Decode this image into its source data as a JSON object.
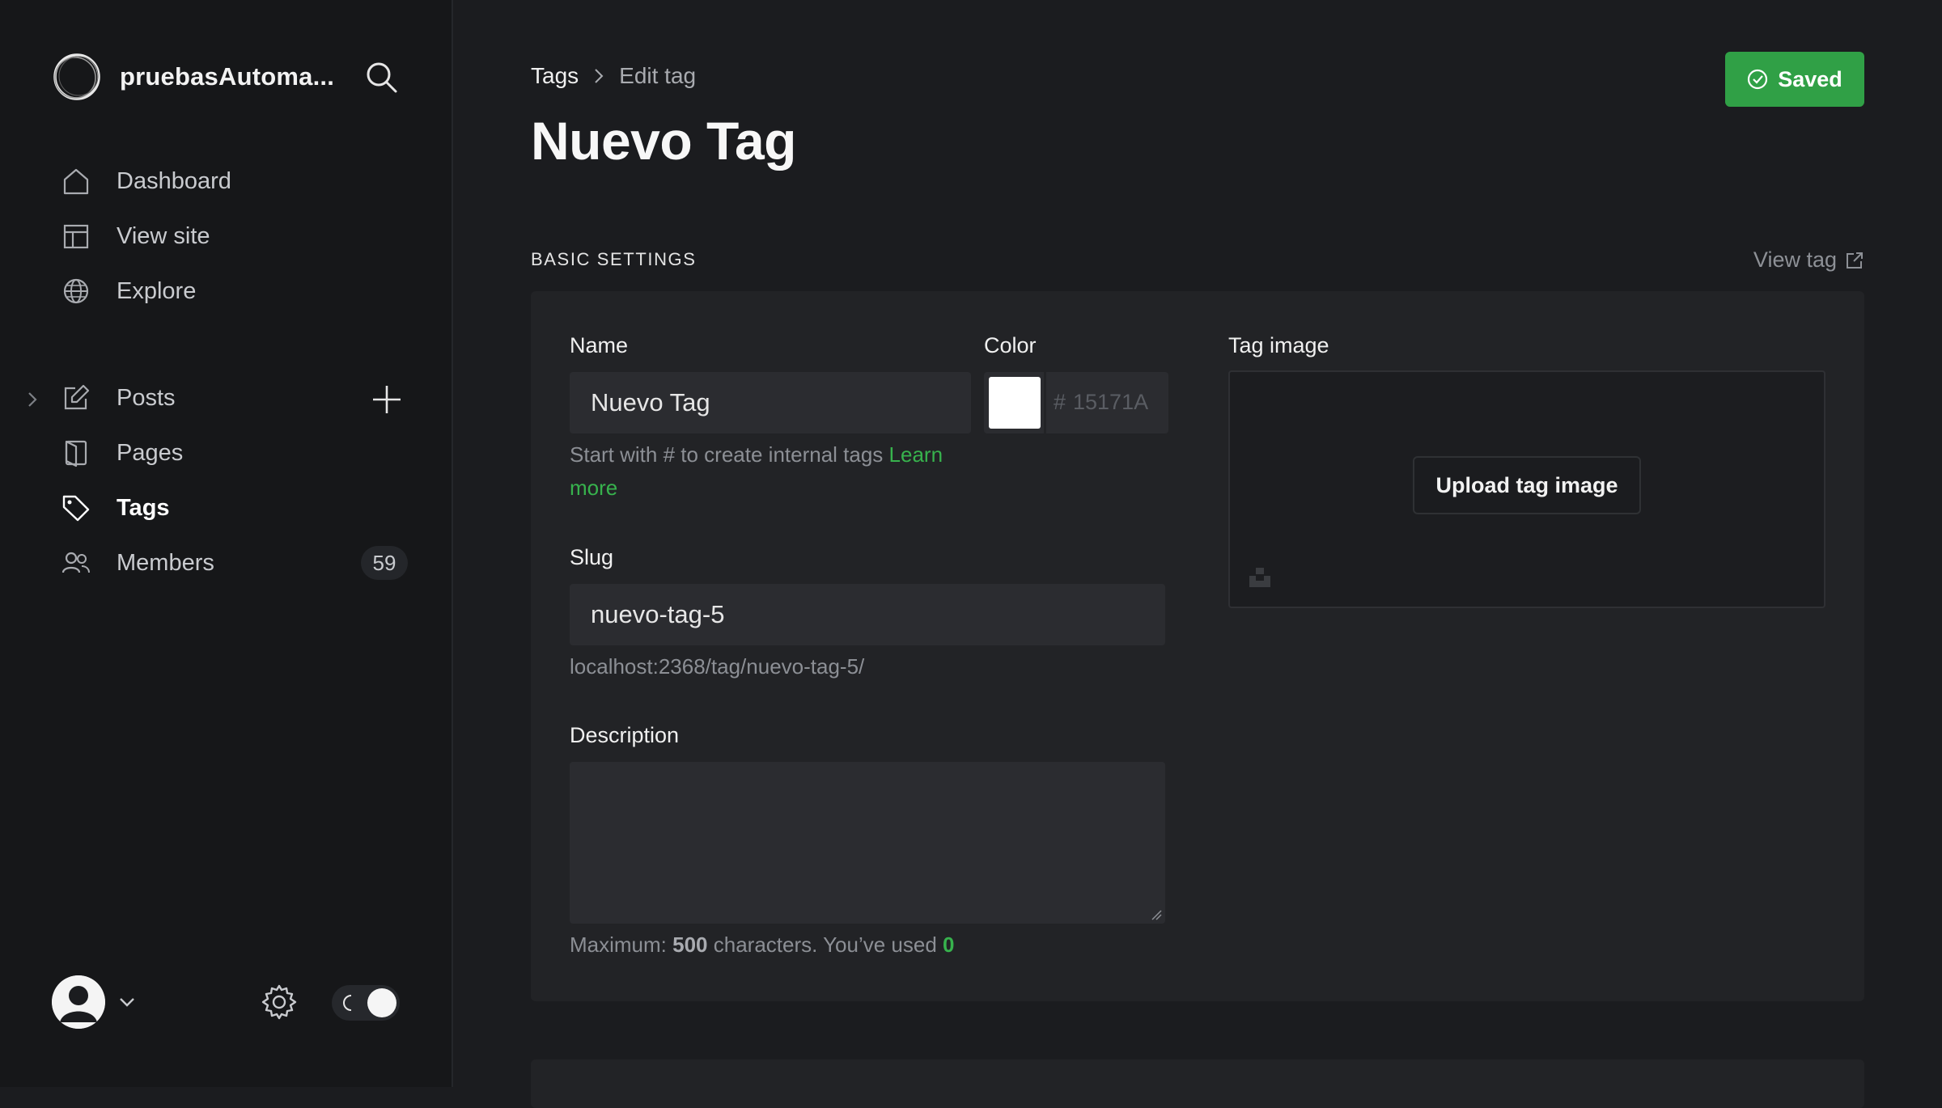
{
  "sidebar": {
    "brand_name": "pruebasAutoma...",
    "nav": {
      "dashboard": "Dashboard",
      "view_site": "View site",
      "explore": "Explore",
      "posts": "Posts",
      "pages": "Pages",
      "tags": "Tags",
      "members": "Members",
      "members_count": "59"
    },
    "active_item": "Tags"
  },
  "header": {
    "breadcrumb_parent": "Tags",
    "breadcrumb_current": "Edit tag",
    "title": "Nuevo Tag",
    "saved_label": "Saved"
  },
  "section": {
    "heading": "BASIC SETTINGS",
    "view_tag": "View tag"
  },
  "form": {
    "name_label": "Name",
    "name_value": "Nuevo Tag",
    "name_hint": "Start with # to create internal tags ",
    "name_hint_link_1": "Learn",
    "name_hint_link_2": "more",
    "color_label": "Color",
    "color_hash": "#",
    "color_placeholder": "15171A",
    "color_value": "#ffffff",
    "slug_label": "Slug",
    "slug_value": "nuevo-tag-5",
    "slug_url": "localhost:2368/tag/nuevo-tag-5/",
    "description_label": "Description",
    "description_value": "",
    "desc_hint_prefix": "Maximum: ",
    "desc_hint_max": "500",
    "desc_hint_middle": " characters. You’ve used ",
    "desc_hint_used": "0",
    "image_label": "Tag image",
    "upload_label": "Upload tag image"
  },
  "colors": {
    "accent": "#30a046",
    "link_green": "#37b24d",
    "background": "#1b1c1f",
    "sidebar": "#161719"
  }
}
